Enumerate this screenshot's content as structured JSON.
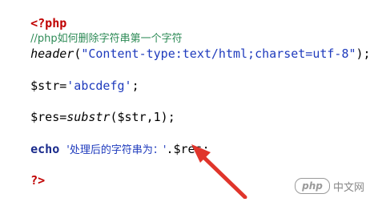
{
  "code": {
    "open_tag": "<?php",
    "comment": "//php如何删除字符串第一个字符",
    "header_func": "header",
    "header_open": "(",
    "header_arg": "\"Content-type:text/html;charset=utf-8\"",
    "header_close": ");",
    "str_var": "$str=",
    "str_val": "'abcdefg'",
    "str_end": ";",
    "res_var": "$res=",
    "substr_func": "substr",
    "substr_args": "($str,1);",
    "echo_kw": "echo",
    "echo_str": "'处理后的字符串为：'",
    "echo_rest": ".$res;",
    "close_tag": "?>"
  },
  "annotation": {
    "arrow_color": "#e0352b"
  },
  "watermark": {
    "logo": "php",
    "site": "中文网"
  }
}
